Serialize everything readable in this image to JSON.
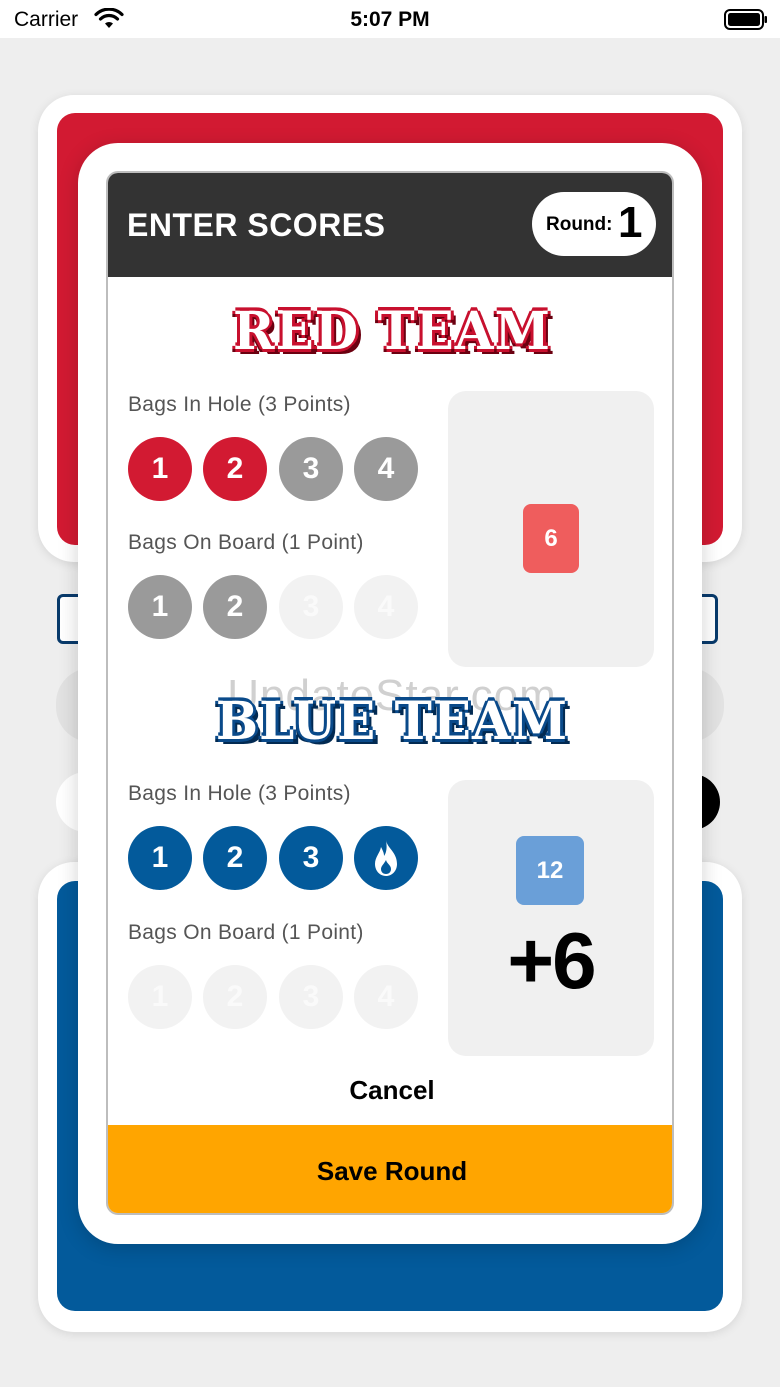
{
  "status_bar": {
    "carrier": "Carrier",
    "time": "5:07 PM"
  },
  "modal": {
    "title": "ENTER SCORES",
    "round_label": "Round:",
    "round_number": "1",
    "watermark": "UpdateStar.com",
    "cancel_label": "Cancel",
    "save_label": "Save Round"
  },
  "red_team": {
    "name": "RED TEAM",
    "hole_label": "Bags In Hole (3 Points)",
    "board_label": "Bags On Board (1 Point)",
    "hole_bags": [
      "1",
      "2",
      "3",
      "4"
    ],
    "board_bags": [
      "1",
      "2",
      "3",
      "4"
    ],
    "hole_selected": 2,
    "board_selected": 2,
    "score": "6"
  },
  "blue_team": {
    "name": "BLUE TEAM",
    "hole_label": "Bags In Hole (3 Points)",
    "board_label": "Bags On Board (1 Point)",
    "hole_bags": [
      "1",
      "2",
      "3",
      "fire-icon"
    ],
    "board_bags": [
      "1",
      "2",
      "3",
      "4"
    ],
    "hole_selected": 4,
    "board_selected": 0,
    "score": "12",
    "diff": "+6"
  },
  "colors": {
    "red": "#d21a32",
    "blue": "#035a9b",
    "save_bar": "#ffa500",
    "header": "#333333"
  }
}
